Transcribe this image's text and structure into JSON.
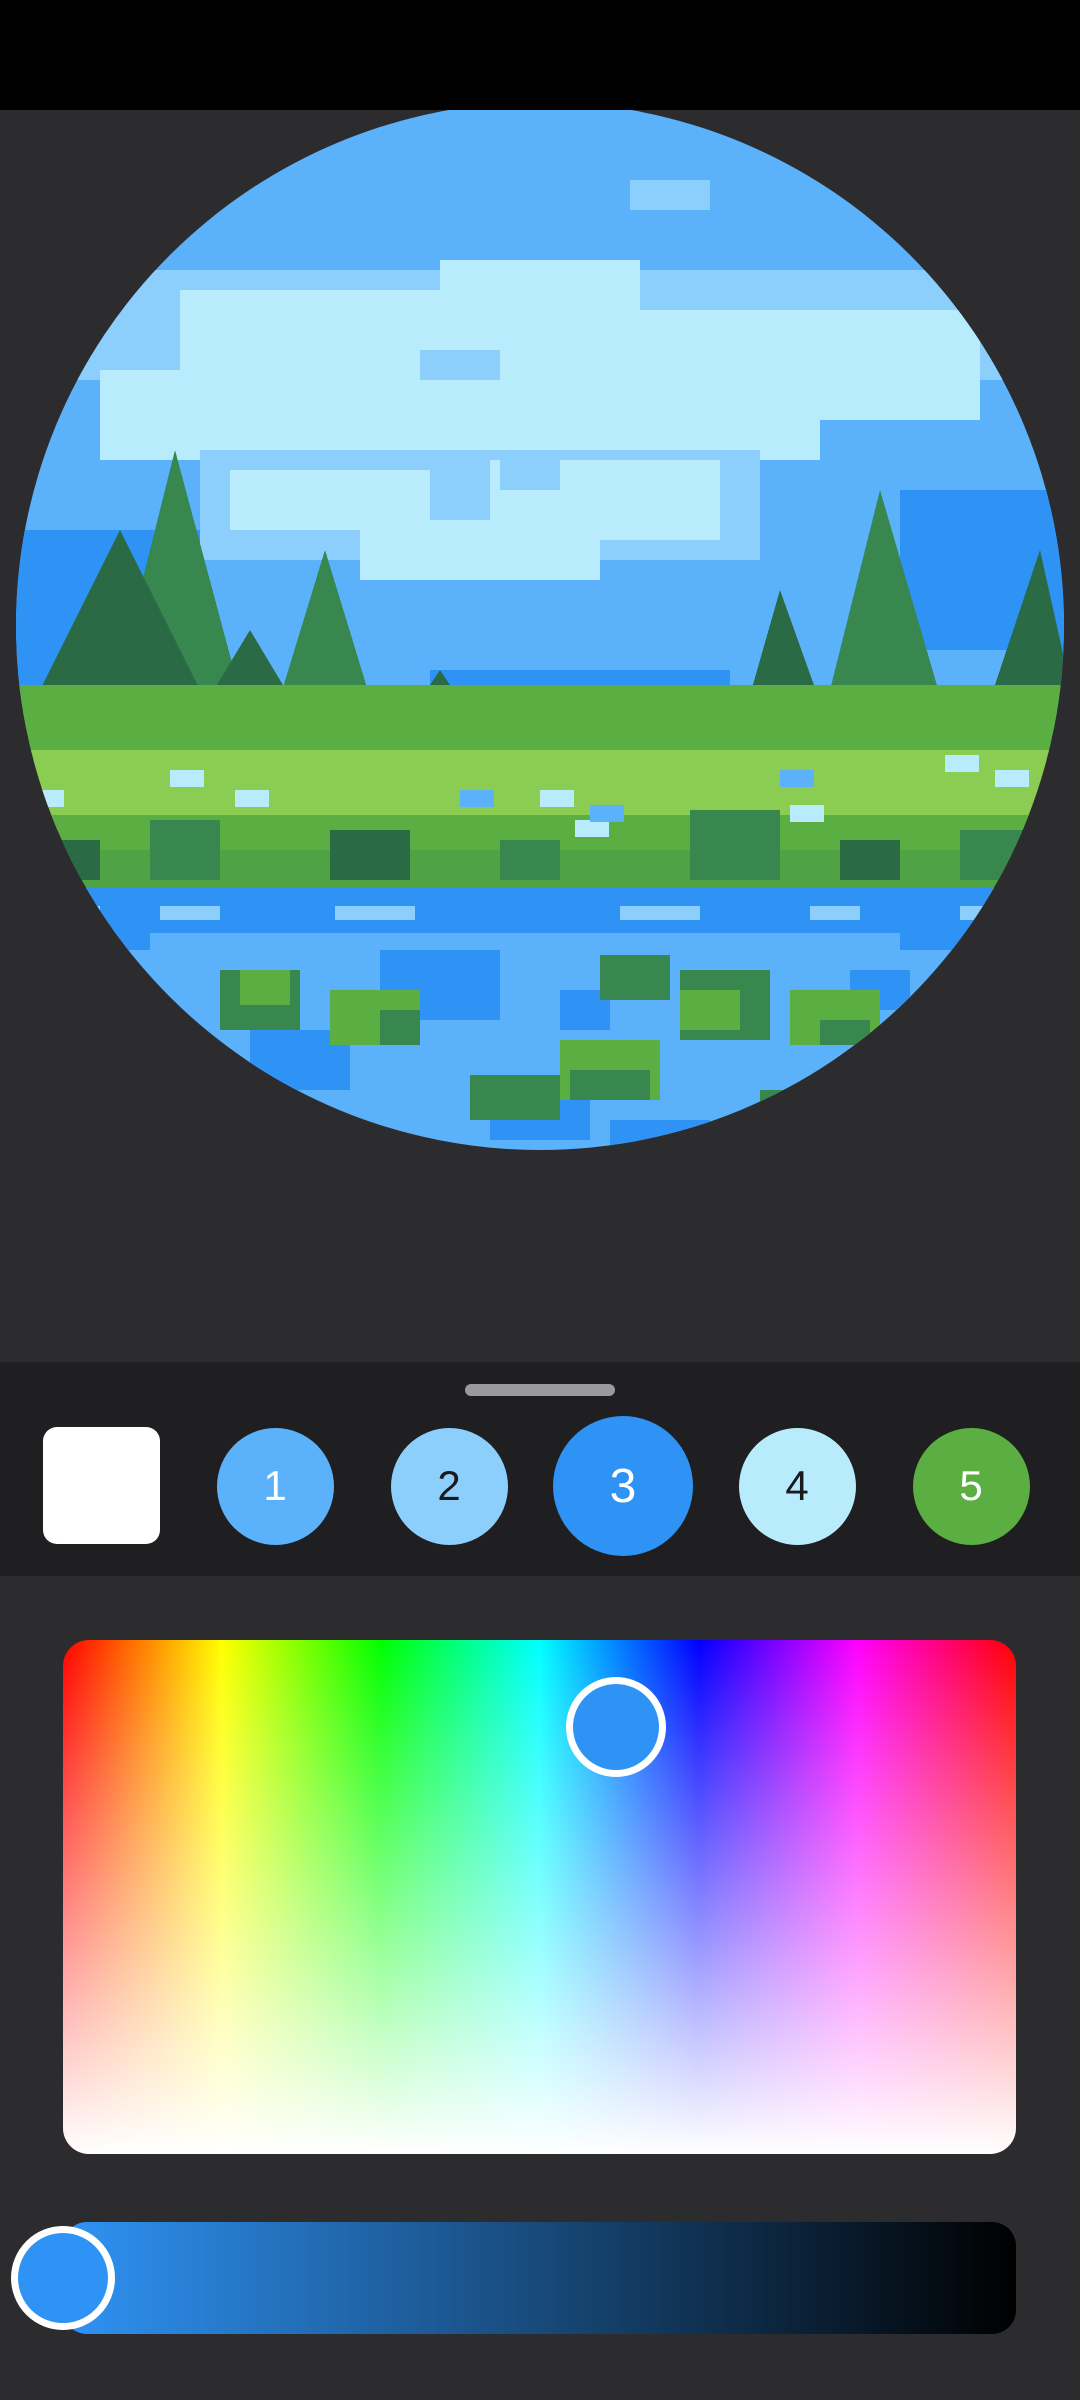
{
  "palette": {
    "selected_index": 2,
    "eraser": {
      "name": "white-swatch",
      "color": "#ffffff"
    },
    "swatches": [
      {
        "number": "1",
        "color": "#5cb1fb",
        "text_color": "#ffffff"
      },
      {
        "number": "2",
        "color": "#8ccffd",
        "text_color": "#1a1a1a"
      },
      {
        "number": "3",
        "color": "#2f93f5",
        "text_color": "#ffffff"
      },
      {
        "number": "4",
        "color": "#b8ecfd",
        "text_color": "#1a1a1a"
      },
      {
        "number": "5",
        "color": "#5aae42",
        "text_color": "#ffffff"
      }
    ]
  },
  "color_picker": {
    "hue_fraction": 0.58,
    "whiteness_fraction": 0.17,
    "current_color": "#2f93f5"
  },
  "brightness": {
    "level_fraction": 0.0,
    "gradient_from": "#2f93f5",
    "gradient_to": "#000000"
  },
  "artwork": {
    "colors": {
      "sky_deep": "#2f93f5",
      "sky_mid": "#5cb1fb",
      "sky_light": "#8ccffd",
      "cloud": "#b8ecfd",
      "tree_dark": "#2a6a45",
      "tree": "#37874e",
      "grass_dark": "#4fa344",
      "grass": "#5aae42",
      "grass_light": "#8bcc52",
      "water": "#5cb1fb",
      "water_deep": "#2f93f5",
      "uncolored": "#5a5a5c"
    }
  }
}
